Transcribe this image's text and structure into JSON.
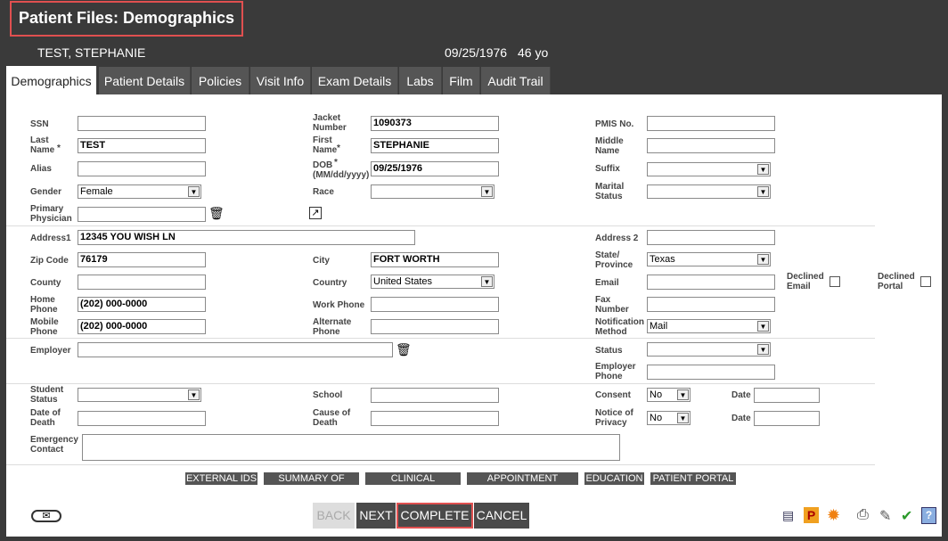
{
  "header": {
    "title": "Patient Files: Demographics"
  },
  "patient": {
    "name": "TEST, STEPHANIE",
    "dob": "09/25/1976",
    "age": "46 yo"
  },
  "tabs": [
    "Demographics",
    "Patient Details",
    "Policies",
    "Visit Info",
    "Exam Details",
    "Labs",
    "Film",
    "Audit Trail"
  ],
  "labels": {
    "ssn": "SSN",
    "jacket": "Jacket Number",
    "pmis": "PMIS No.",
    "last_name": "Last Name",
    "first_name": "First Name",
    "middle_name": "Middle Name",
    "alias": "Alias",
    "dob": "DOB (MM/dd/yyyy)",
    "suffix": "Suffix",
    "gender": "Gender",
    "race": "Race",
    "marital": "Marital Status",
    "primary_physician": "Primary Physician",
    "address1": "Address1",
    "address2": "Address 2",
    "zip": "Zip Code",
    "city": "City",
    "state": "State/ Province",
    "county": "County",
    "country": "Country",
    "email": "Email",
    "declined_email": "Declined Email",
    "declined_portal": "Declined Portal",
    "home_phone": "Home Phone",
    "work_phone": "Work Phone",
    "fax": "Fax Number",
    "mobile_phone": "Mobile Phone",
    "alt_phone": "Alternate Phone",
    "notification": "Notification Method",
    "employer": "Employer",
    "status": "Status",
    "employer_phone": "Employer Phone",
    "student_status": "Student Status",
    "school": "School",
    "consent": "Consent",
    "date": "Date",
    "date_of_death": "Date of Death",
    "cause_of_death": "Cause of Death",
    "notice_privacy": "Notice of Privacy",
    "emergency_contact": "Emergency Contact",
    "required_mark": "*"
  },
  "values": {
    "jacket": "1090373",
    "last_name": "TEST",
    "first_name": "STEPHANIE",
    "dob": "09/25/1976",
    "gender": "Female",
    "address1": "12345 YOU WISH LN",
    "zip": "76179",
    "city": "FORT WORTH",
    "state": "Texas",
    "country": "United States",
    "home_phone": "(202) 000-0000",
    "mobile_phone": "(202) 000-0000",
    "notification": "Mail",
    "consent": "No",
    "notice_privacy": "No"
  },
  "sub_buttons": [
    "EXTERNAL IDS",
    "SUMMARY OF CARE",
    "CLINICAL SUMMARY",
    "APPOINTMENT DETAILS",
    "EDUCATION",
    "PATIENT PORTAL"
  ],
  "bottom_buttons": {
    "back": "BACK",
    "next": "NEXT",
    "complete": "COMPLETE",
    "cancel": "CANCEL"
  },
  "icons": {
    "arrow": "▼",
    "trash": "🗑",
    "link": "↗",
    "mail": "✉",
    "print_icon": "▤",
    "p_icon": "P",
    "gear": "✹",
    "printer": "⎙",
    "edit": "✎",
    "check": "✔",
    "help": "?"
  },
  "colors": {
    "highlight": "#e05050",
    "required": "#d02020",
    "dark": "#3a3a3a"
  }
}
